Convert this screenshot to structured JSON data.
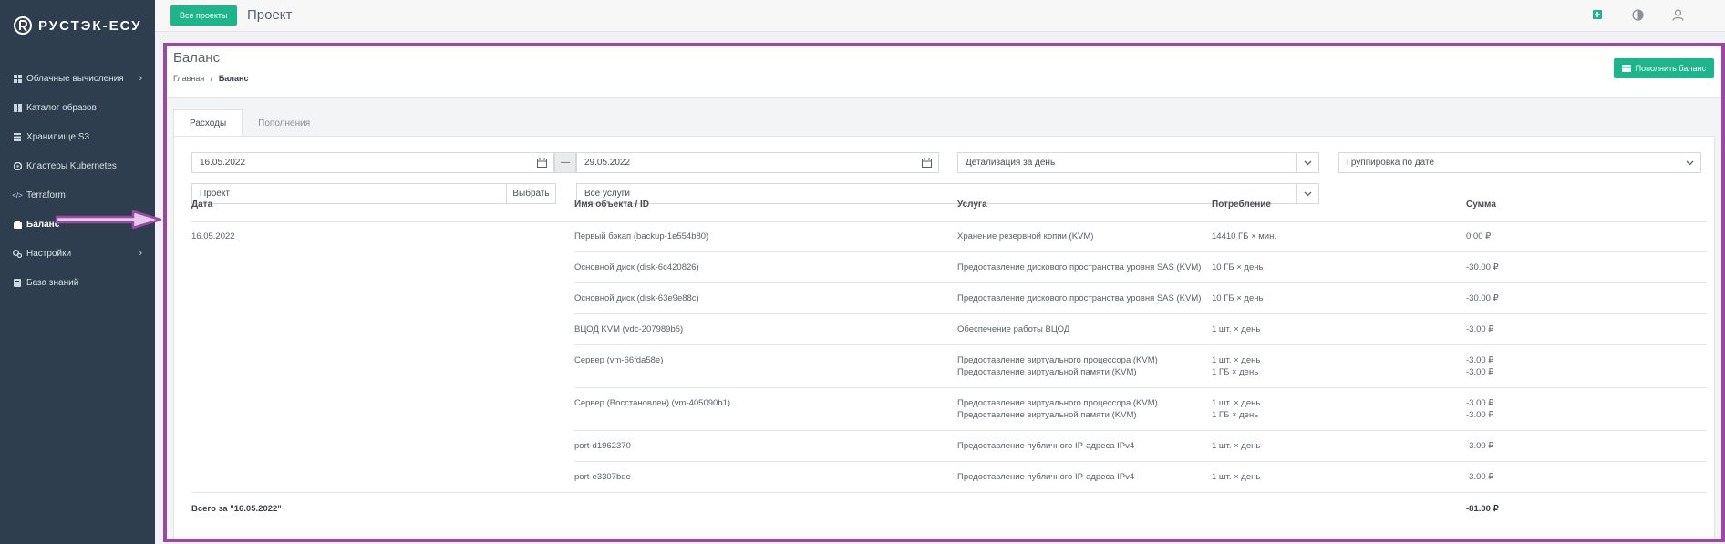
{
  "app": {
    "logo_text": "РУСТЭК-ЕСУ"
  },
  "sidebar": {
    "items": [
      {
        "label": "Облачные вычисления",
        "icon": "grid-icon",
        "has_chevron": true
      },
      {
        "label": "Каталог образов",
        "icon": "grid-icon",
        "has_chevron": false
      },
      {
        "label": "Хранилище S3",
        "icon": "storage-icon",
        "has_chevron": false
      },
      {
        "label": "Кластеры Kubernetes",
        "icon": "kubernetes-icon",
        "has_chevron": false
      },
      {
        "label": "Terraform",
        "icon": "code-icon",
        "has_chevron": false
      },
      {
        "label": "Баланс",
        "icon": "wallet-icon",
        "has_chevron": false,
        "active": true
      },
      {
        "label": "Настройки",
        "icon": "gears-icon",
        "has_chevron": true
      },
      {
        "label": "База знаний",
        "icon": "book-icon",
        "has_chevron": false
      }
    ]
  },
  "topbar": {
    "all_projects_label": "Все проекты",
    "title": "Проект"
  },
  "page": {
    "title": "Баланс",
    "breadcrumb": {
      "home": "Главная",
      "separator": "/",
      "current": "Баланс"
    },
    "topup_label": "Пополнить баланс"
  },
  "tabs": [
    {
      "label": "Расходы",
      "active": true
    },
    {
      "label": "Пополнения",
      "active": false
    }
  ],
  "filters": {
    "date_from": "16.05.2022",
    "date_sep": "—",
    "date_to": "29.05.2022",
    "detail": "Детализация за день",
    "grouping": "Группировка по дате",
    "project_placeholder": "Проект",
    "pick_label": "Выбрать",
    "services": "Все услуги"
  },
  "table": {
    "headers": {
      "date": "Дата",
      "object": "Имя объекта / ID",
      "service": "Услуга",
      "usage": "Потребление",
      "sum": "Сумма"
    },
    "date": "16.05.2022",
    "rows": [
      {
        "object": "Первый бэкап (backup-1e554b80)",
        "services": [
          "Хранение резервной копии (KVM)"
        ],
        "usage": [
          "14410 ГБ × мин."
        ],
        "sums": [
          "0.00 ₽"
        ]
      },
      {
        "object": "Основной диск (disk-6c420826)",
        "services": [
          "Предоставление дискового пространства уровня SAS (KVM)"
        ],
        "usage": [
          "10 ГБ × день"
        ],
        "sums": [
          "-30.00 ₽"
        ]
      },
      {
        "object": "Основной диск (disk-63e9e88c)",
        "services": [
          "Предоставление дискового пространства уровня SAS (KVM)"
        ],
        "usage": [
          "10 ГБ × день"
        ],
        "sums": [
          "-30.00 ₽"
        ]
      },
      {
        "object": "ВЦОД KVM (vdc-207989b5)",
        "services": [
          "Обеспечение работы ВЦОД"
        ],
        "usage": [
          "1 шт. × день"
        ],
        "sums": [
          "-3.00 ₽"
        ]
      },
      {
        "object": "Сервер (vm-66fda58e)",
        "services": [
          "Предоставление виртуального процессора (KVM)",
          "Предоставление виртуальной памяти (KVM)"
        ],
        "usage": [
          "1 шт. × день",
          "1 ГБ × день"
        ],
        "sums": [
          "-3.00 ₽",
          "-3.00 ₽"
        ]
      },
      {
        "object": "Сервер (Восстановлен) (vm-405090b1)",
        "services": [
          "Предоставление виртуального процессора (KVM)",
          "Предоставление виртуальной памяти (KVM)"
        ],
        "usage": [
          "1 шт. × день",
          "1 ГБ × день"
        ],
        "sums": [
          "-3.00 ₽",
          "-3.00 ₽"
        ]
      },
      {
        "object": "port-d1962370",
        "services": [
          "Предоставление публичного IP-адреса IPv4"
        ],
        "usage": [
          "1 шт. × день"
        ],
        "sums": [
          "-3.00 ₽"
        ]
      },
      {
        "object": "port-e3307bde",
        "services": [
          "Предоставление публичного IP-адреса IPv4"
        ],
        "usage": [
          "1 шт. × день"
        ],
        "sums": [
          "-3.00 ₽"
        ]
      }
    ],
    "total_label": "Всего за \"16.05.2022\"",
    "total_sum": "-81.00 ₽"
  },
  "colors": {
    "sidebar_bg": "#2f3e4e",
    "accent": "#1db58a",
    "highlight": "#9a48a5"
  }
}
